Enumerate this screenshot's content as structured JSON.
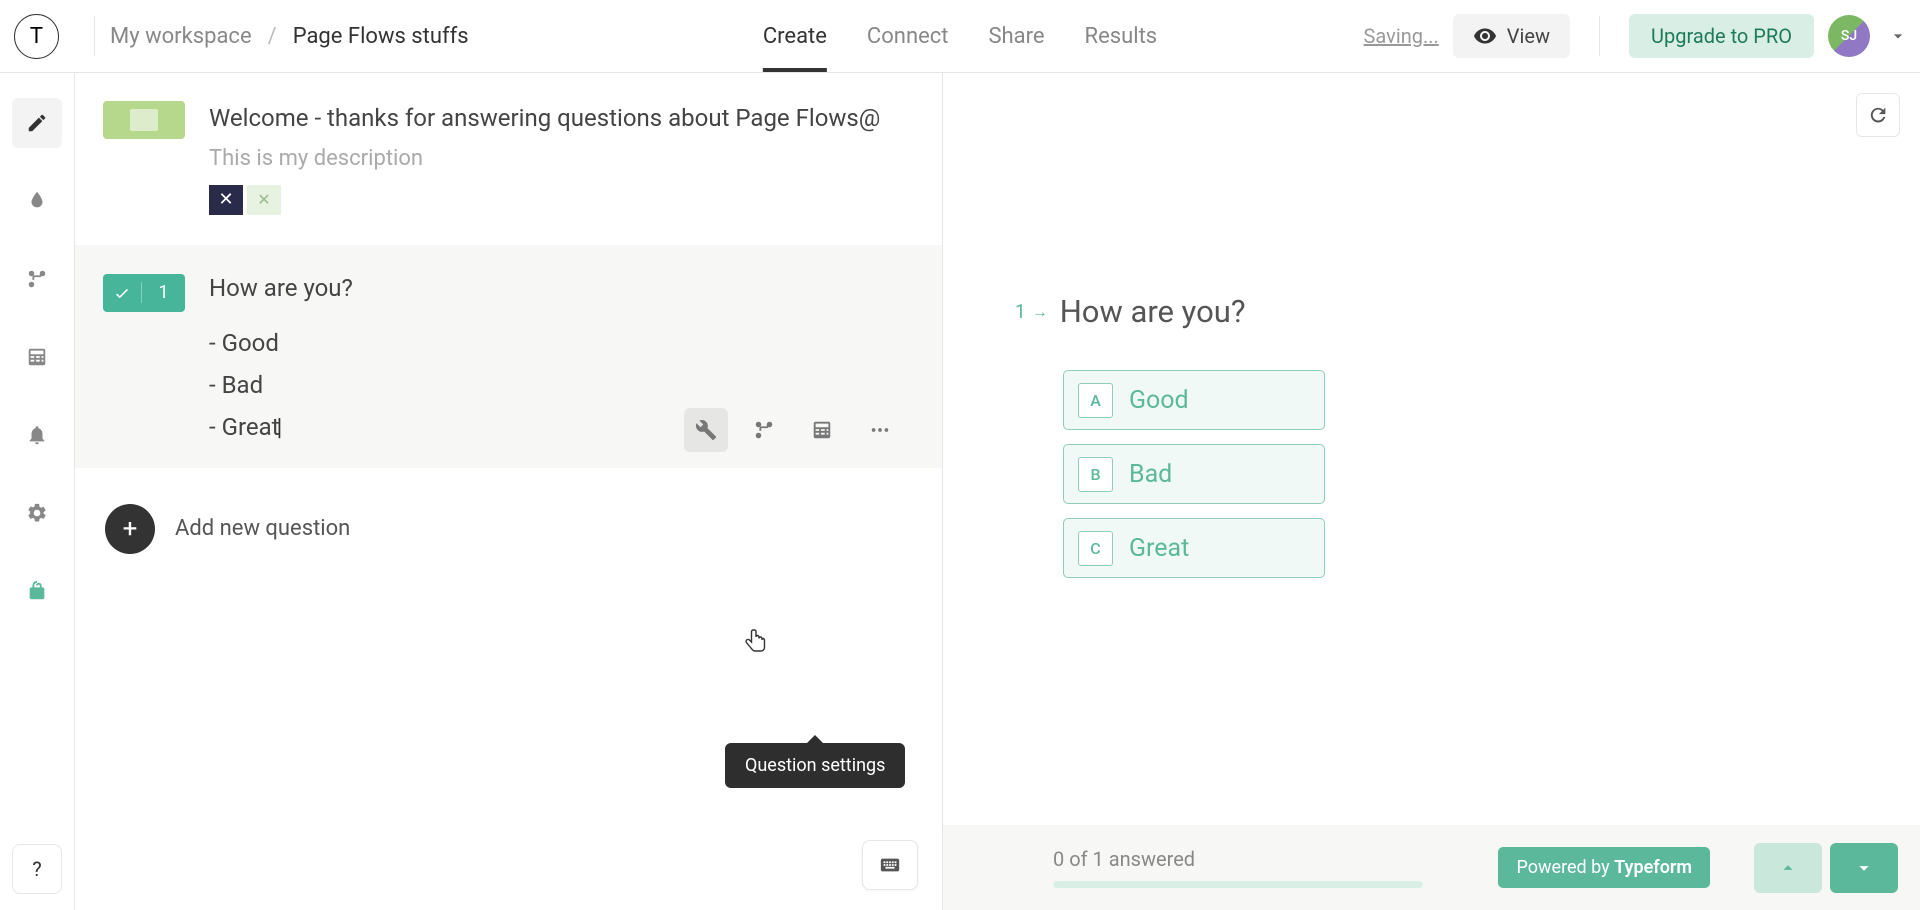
{
  "header": {
    "logo_letter": "T",
    "workspace": "My workspace",
    "separator": "/",
    "project": "Page Flows stuffs",
    "saving": "Saving...",
    "view_label": "View",
    "upgrade_label": "Upgrade to PRO",
    "avatar_initials": "SJ"
  },
  "tabs": {
    "create": "Create",
    "connect": "Connect",
    "share": "Share",
    "results": "Results"
  },
  "welcome": {
    "title": "Welcome - thanks for answering questions about Page Flows@",
    "description": "This is my description"
  },
  "question": {
    "number": "1",
    "title": "How are you?",
    "opt1": "Good",
    "opt2": "Bad",
    "opt3": "Great"
  },
  "tooltip": {
    "question_settings": "Question settings"
  },
  "add_question_label": "Add new question",
  "preview": {
    "q_number": "1",
    "q_title": "How are you?",
    "options": [
      {
        "key": "A",
        "label": "Good"
      },
      {
        "key": "B",
        "label": "Bad"
      },
      {
        "key": "C",
        "label": "Great"
      }
    ],
    "progress_text": "0 of 1 answered",
    "powered_prefix": "Powered by ",
    "powered_brand": "Typeform"
  }
}
